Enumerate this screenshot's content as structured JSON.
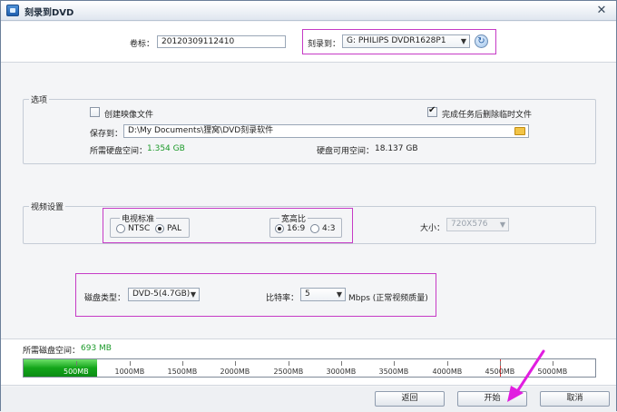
{
  "window": {
    "title": "刻录到DVD",
    "close_glyph": "✕"
  },
  "top": {
    "volume_label": "卷标：",
    "volume_value": "20120309112410",
    "burn_to_label": "刻录到：",
    "burn_to_value": "G: PHILIPS  DVDR1628P1"
  },
  "options": {
    "title": "选项",
    "create_image_label": "创建映像文件",
    "create_image_checked": false,
    "delete_temp_label": "完成任务后删除临时文件",
    "delete_temp_checked": true,
    "save_to_label": "保存到：",
    "save_to_value": "D:\\My Documents\\狸窝\\DVD刻录软件",
    "required_space_label": "所需硬盘空间：",
    "required_space_value": "1.354 GB",
    "available_space_label": "硬盘可用空间：",
    "available_space_value": "18.137 GB"
  },
  "video": {
    "title": "视频设置",
    "tv_standard_title": "电视标准",
    "ntsc_label": "NTSC",
    "pal_label": "PAL",
    "tv_standard_selected": "PAL",
    "aspect_title": "宽高比",
    "aspect_169_label": "16:9",
    "aspect_43_label": "4:3",
    "aspect_selected": "16:9",
    "size_label": "大小：",
    "size_value": "720X576"
  },
  "disc": {
    "type_label": "磁盘类型：",
    "type_value": "DVD-5(4.7GB)",
    "bitrate_label": "比特率：",
    "bitrate_value": "5",
    "bitrate_unit": "Mbps (正常视频质量)"
  },
  "usage": {
    "label": "所需磁盘空间：",
    "value": "693 MB",
    "used_mb": 693,
    "max_mb": 5400,
    "capacity_marker_mb": 4500,
    "ticks": [
      "500MB",
      "1000MB",
      "1500MB",
      "2000MB",
      "2500MB",
      "3000MB",
      "3500MB",
      "4000MB",
      "4500MB",
      "5000MB"
    ]
  },
  "footer": {
    "back_label": "返回",
    "start_label": "开始",
    "cancel_label": "取消"
  },
  "colors": {
    "accent_highlight": "#c63bc6",
    "used_green": "#13a51a",
    "space_green": "#1c9a2a",
    "capacity_marker": "#e03a3a"
  }
}
